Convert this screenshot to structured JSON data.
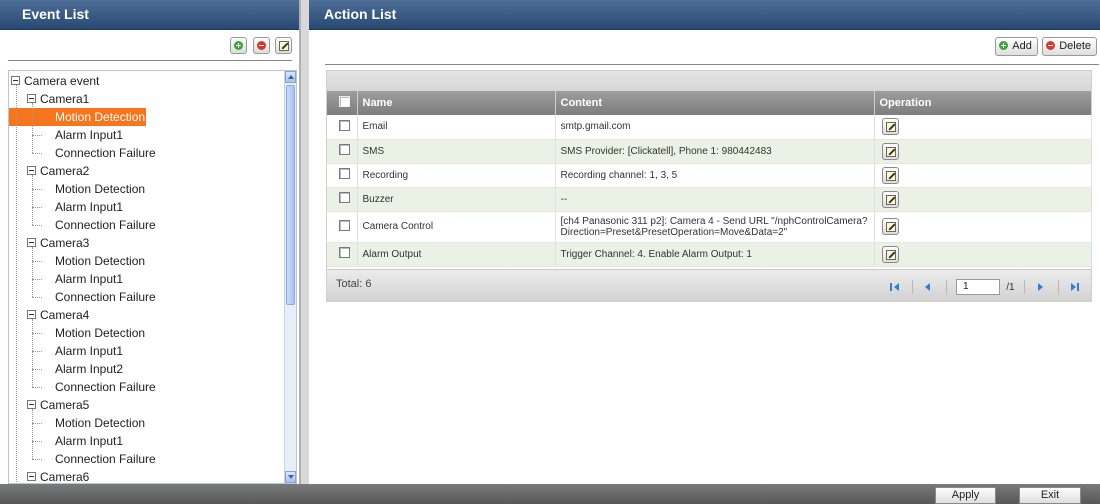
{
  "event_panel": {
    "title": "Event List",
    "tree": {
      "root": "Camera event",
      "cameras": [
        {
          "label": "Camera1",
          "children": [
            "Motion Detection",
            "Alarm Input1",
            "Connection Failure"
          ]
        },
        {
          "label": "Camera2",
          "children": [
            "Motion Detection",
            "Alarm Input1",
            "Connection Failure"
          ]
        },
        {
          "label": "Camera3",
          "children": [
            "Motion Detection",
            "Alarm Input1",
            "Connection Failure"
          ]
        },
        {
          "label": "Camera4",
          "children": [
            "Motion Detection",
            "Alarm Input1",
            "Alarm Input2",
            "Connection Failure"
          ]
        },
        {
          "label": "Camera5",
          "children": [
            "Motion Detection",
            "Alarm Input1",
            "Connection Failure"
          ]
        },
        {
          "label": "Camera6",
          "children": []
        }
      ],
      "selected": "Camera1 / Motion Detection"
    },
    "toolbar_icons": [
      "add-icon",
      "remove-icon",
      "edit-icon"
    ]
  },
  "action_panel": {
    "title": "Action List",
    "add_label": "Add",
    "delete_label": "Delete",
    "columns": [
      "Name",
      "Content",
      "Operation"
    ],
    "rows": [
      {
        "name": "Email",
        "content": "smtp.gmail.com"
      },
      {
        "name": "SMS",
        "content": "SMS Provider: [Clickatell], Phone 1: 980442483"
      },
      {
        "name": "Recording",
        "content": "Recording channel: 1, 3, 5"
      },
      {
        "name": "Buzzer",
        "content": "--"
      },
      {
        "name": "Camera Control",
        "content": "[ch4 Panasonic 311 p2]: Camera 4 - Send URL \"/nphControlCamera?Direction=Preset&PresetOperation=Move&Data=2\""
      },
      {
        "name": "Alarm Output",
        "content": "Trigger Channel: 4. Enable Alarm Output: 1"
      }
    ],
    "total_label": "Total: 6",
    "pager": {
      "page": "1",
      "of": "/1"
    }
  },
  "footer": {
    "apply_label": "Apply",
    "exit_label": "Exit"
  },
  "colors": {
    "header": "#284a72",
    "selected": "#f7751d",
    "row_alt": "#e9f2e4",
    "grid_header": "#8a8a8a"
  }
}
